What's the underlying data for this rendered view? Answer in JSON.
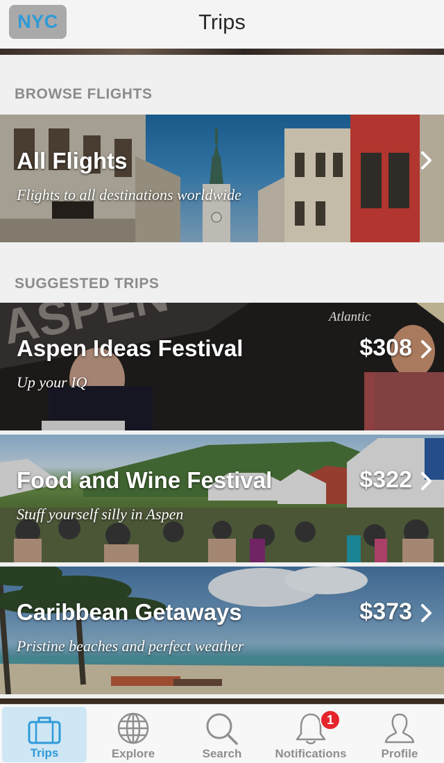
{
  "nav": {
    "city": "NYC",
    "title": "Trips"
  },
  "sections": {
    "browse": "BROWSE FLIGHTS",
    "suggested": "SUGGESTED TRIPS"
  },
  "all_flights": {
    "title": "All Flights",
    "subtitle": "Flights to all destinations worldwide"
  },
  "trips": [
    {
      "title": "Aspen Ideas Festival",
      "subtitle": "Up your IQ",
      "price": "$308",
      "logo": "Atlantic"
    },
    {
      "title": "Food and Wine Festival",
      "subtitle": "Stuff yourself silly in Aspen",
      "price": "$322"
    },
    {
      "title": "Caribbean Getaways",
      "subtitle": "Pristine beaches and perfect weather",
      "price": "$373"
    }
  ],
  "tabs": [
    {
      "label": "Trips",
      "icon": "briefcase-icon"
    },
    {
      "label": "Explore",
      "icon": "globe-icon"
    },
    {
      "label": "Search",
      "icon": "search-icon"
    },
    {
      "label": "Notifications",
      "icon": "bell-icon"
    },
    {
      "label": "Profile",
      "icon": "person-icon"
    }
  ],
  "notifications_badge": "1",
  "colors": {
    "accent": "#2e9ad8",
    "badge": "#e5242b",
    "active_tab_bg": "#cfe6f5"
  }
}
